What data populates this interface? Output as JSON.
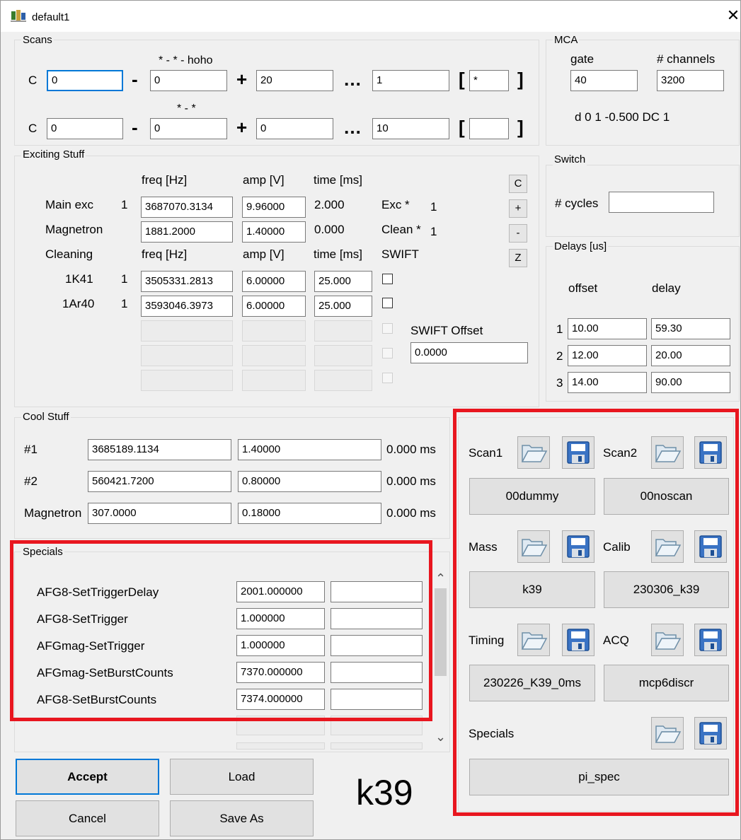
{
  "window": {
    "title": "default1",
    "close_glyph": "✕"
  },
  "scans": {
    "group_label": "Scans",
    "row1": {
      "prefix": "C",
      "start": "0",
      "mid_label": "* - * - hoho",
      "offset": "0",
      "step": "20",
      "count": "1",
      "bracket_val": "*"
    },
    "row2": {
      "prefix": "C",
      "start": "0",
      "mid_label": "* - *",
      "offset": "0",
      "step": "0",
      "count": "10",
      "bracket_val": ""
    },
    "minus": "-",
    "plus": "+",
    "ellipsis": "…",
    "bracket_open": "[",
    "bracket_close": "]"
  },
  "mca": {
    "group_label": "MCA",
    "gate_label": "gate",
    "gate_value": "40",
    "channels_label": "# channels",
    "channels_value": "3200",
    "info": "d 0 1 -0.500 DC 1"
  },
  "exciting": {
    "group_label": "Exciting Stuff",
    "header": {
      "freq": "freq [Hz]",
      "amp": "amp [V]",
      "time": "time [ms]"
    },
    "main_exc": {
      "label": "Main exc",
      "num": "1",
      "freq": "3687070.3134",
      "amp": "9.96000",
      "time": "2.000",
      "side_label": "Exc *",
      "side_num": "1"
    },
    "magnetron": {
      "label": "Magnetron",
      "freq": "1881.2000",
      "amp": "1.40000",
      "time": "0.000",
      "side_label": "Clean *",
      "side_num": "1"
    },
    "cleaning_header": {
      "label": "Cleaning",
      "freq": "freq [Hz]",
      "amp": "amp [V]",
      "time": "time [ms]",
      "swift": "SWIFT"
    },
    "rows": [
      {
        "label": "1K41",
        "num": "1",
        "freq": "3505331.2813",
        "amp": "6.00000",
        "time": "25.000"
      },
      {
        "label": "1Ar40",
        "num": "1",
        "freq": "3593046.3973",
        "amp": "6.00000",
        "time": "25.000"
      }
    ],
    "swift_offset_label": "SWIFT Offset",
    "swift_offset_value": "0.0000",
    "side_buttons": [
      "C",
      "+",
      "-",
      "Z"
    ]
  },
  "switch": {
    "group_label": "Switch",
    "cycles_label": "# cycles",
    "cycles_value": ""
  },
  "delays": {
    "group_label": "Delays [us]",
    "offset_label": "offset",
    "delay_label": "delay",
    "rows": [
      {
        "n": "1",
        "offset": "10.00",
        "delay": "59.30"
      },
      {
        "n": "2",
        "offset": "12.00",
        "delay": "20.00"
      },
      {
        "n": "3",
        "offset": "14.00",
        "delay": "90.00"
      }
    ]
  },
  "cool": {
    "group_label": "Cool Stuff",
    "rows": [
      {
        "label": "#1",
        "freq": "3685189.1134",
        "amp": "1.40000",
        "time": "0.000 ms"
      },
      {
        "label": "#2",
        "freq": "560421.7200",
        "amp": "0.80000",
        "time": "0.000 ms"
      },
      {
        "label": "Magnetron",
        "freq": "307.0000",
        "amp": "0.18000",
        "time": "0.000 ms"
      }
    ]
  },
  "specials": {
    "group_label": "Specials",
    "rows": [
      {
        "label": "AFG8-SetTriggerDelay",
        "value": "2001.000000",
        "extra": ""
      },
      {
        "label": "AFG8-SetTrigger",
        "value": "1.000000",
        "extra": ""
      },
      {
        "label": "AFGmag-SetTrigger",
        "value": "1.000000",
        "extra": ""
      },
      {
        "label": "AFGmag-SetBurstCounts",
        "value": "7370.000000",
        "extra": ""
      },
      {
        "label": "AFG8-SetBurstCounts",
        "value": "7374.000000",
        "extra": ""
      }
    ],
    "scroll_up": "⌃",
    "scroll_down": "⌄"
  },
  "files": {
    "scan1": {
      "label": "Scan1",
      "value": "00dummy"
    },
    "scan2": {
      "label": "Scan2",
      "value": "00noscan"
    },
    "mass": {
      "label": "Mass",
      "value": "k39"
    },
    "calib": {
      "label": "Calib",
      "value": "230306_k39"
    },
    "timing": {
      "label": "Timing",
      "value": "230226_K39_0ms"
    },
    "acq": {
      "label": "ACQ",
      "value": "mcp6discr"
    },
    "specials": {
      "label": "Specials",
      "value": "pi_spec"
    }
  },
  "footer": {
    "accept": "Accept",
    "load": "Load",
    "cancel": "Cancel",
    "save_as": "Save As",
    "big_label": "k39"
  },
  "colors": {
    "highlight": "#e8161f",
    "focus": "#0078d7"
  },
  "icons": [
    "window-app-icon",
    "folder-open-icon",
    "floppy-save-icon"
  ]
}
